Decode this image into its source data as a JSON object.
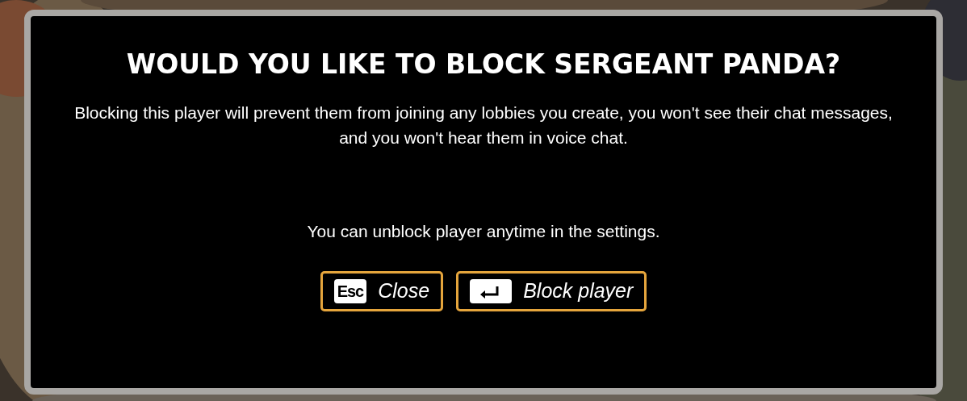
{
  "dialog": {
    "title": "WOULD YOU LIKE TO BLOCK SERGEANT PANDA?",
    "message": "Blocking this player will prevent them from joining any lobbies you create, you won't see their chat messages, and you won't hear them in voice chat.",
    "note": "You can unblock player anytime in the settings.",
    "buttons": [
      {
        "kind": "text-key",
        "key": "Esc",
        "label": "Close"
      },
      {
        "kind": "enter-key",
        "label": "Block player"
      }
    ]
  }
}
